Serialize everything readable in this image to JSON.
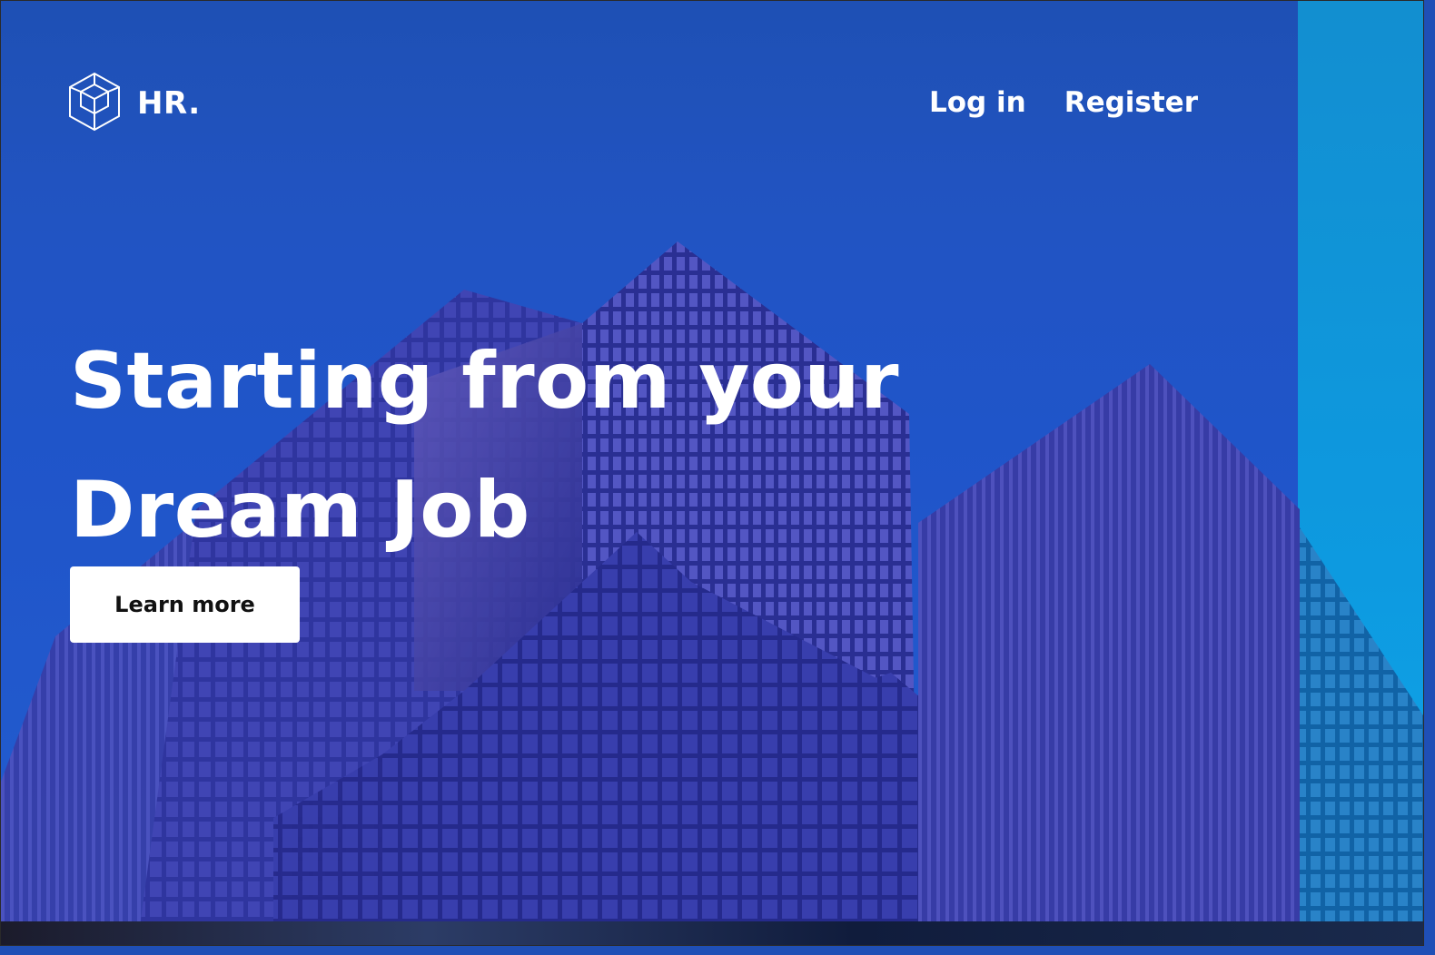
{
  "brand": {
    "logo_icon": "cube-icon",
    "name": "HR."
  },
  "nav": {
    "login_label": "Log in",
    "register_label": "Register"
  },
  "hero": {
    "headline_line1": "Starting from your",
    "headline_line2": "Dream Job",
    "cta_label": "Learn more"
  },
  "colors": {
    "background": "#1f55c0",
    "accent_right": "#0ba9ea",
    "text": "#ffffff",
    "button_bg": "#ffffff",
    "button_text": "#111111"
  }
}
